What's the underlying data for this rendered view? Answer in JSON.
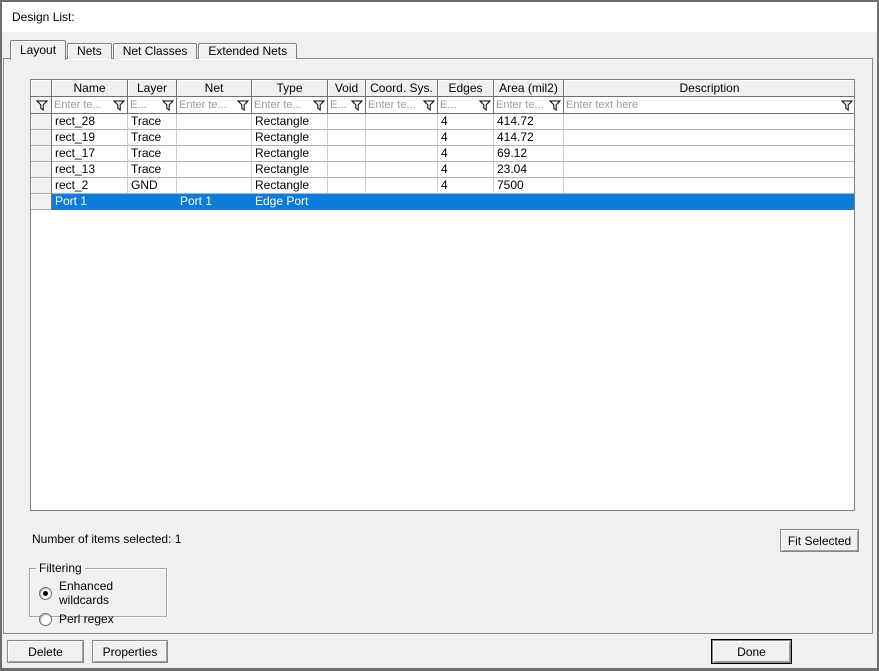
{
  "dialog": {
    "title": "Design List:"
  },
  "tabs": [
    {
      "label": "Layout",
      "active": true
    },
    {
      "label": "Nets",
      "active": false
    },
    {
      "label": "Net Classes",
      "active": false
    },
    {
      "label": "Extended Nets",
      "active": false
    }
  ],
  "table": {
    "columns": [
      {
        "name": "row-selector",
        "label": "",
        "filter_placeholder": ""
      },
      {
        "name": "name",
        "label": "Name",
        "filter_placeholder": "Enter te..."
      },
      {
        "name": "layer",
        "label": "Layer",
        "filter_placeholder": "E..."
      },
      {
        "name": "net",
        "label": "Net",
        "filter_placeholder": "Enter te..."
      },
      {
        "name": "type",
        "label": "Type",
        "filter_placeholder": "Enter te..."
      },
      {
        "name": "void",
        "label": "Void",
        "filter_placeholder": "E..."
      },
      {
        "name": "coord-sys",
        "label": "Coord. Sys.",
        "filter_placeholder": "Enter te..."
      },
      {
        "name": "edges",
        "label": "Edges",
        "filter_placeholder": "E..."
      },
      {
        "name": "area",
        "label": "Area (mil2)",
        "filter_placeholder": "Enter te..."
      },
      {
        "name": "description",
        "label": "Description",
        "filter_placeholder": "Enter text here"
      }
    ],
    "rows": [
      {
        "selected": false,
        "cells": [
          "",
          "rect_28",
          "Trace",
          "",
          "Rectangle",
          "",
          "",
          "4",
          "414.72",
          ""
        ]
      },
      {
        "selected": false,
        "cells": [
          "",
          "rect_19",
          "Trace",
          "",
          "Rectangle",
          "",
          "",
          "4",
          "414.72",
          ""
        ]
      },
      {
        "selected": false,
        "cells": [
          "",
          "rect_17",
          "Trace",
          "",
          "Rectangle",
          "",
          "",
          "4",
          "69.12",
          ""
        ]
      },
      {
        "selected": false,
        "cells": [
          "",
          "rect_13",
          "Trace",
          "",
          "Rectangle",
          "",
          "",
          "4",
          "23.04",
          ""
        ]
      },
      {
        "selected": false,
        "cells": [
          "",
          "rect_2",
          "GND",
          "",
          "Rectangle",
          "",
          "",
          "4",
          "7500",
          ""
        ]
      },
      {
        "selected": true,
        "cells": [
          "",
          "Port 1",
          "",
          "Port 1",
          "Edge Port",
          "",
          "",
          "",
          "",
          ""
        ]
      }
    ]
  },
  "status": {
    "items_selected": "Number of items selected: 1"
  },
  "filtering": {
    "title": "Filtering",
    "options": [
      {
        "label": "Enhanced wildcards",
        "selected": true
      },
      {
        "label": "Perl regex",
        "selected": false
      }
    ]
  },
  "buttons": {
    "fit_selected": "Fit Selected",
    "delete": "Delete",
    "properties": "Properties",
    "done": "Done"
  },
  "icons": {
    "filter": "filter-funnel-icon"
  },
  "colors": {
    "selection": "#0d7bd8",
    "titlebar": "#ffffff",
    "client": "#f0f0f0"
  }
}
